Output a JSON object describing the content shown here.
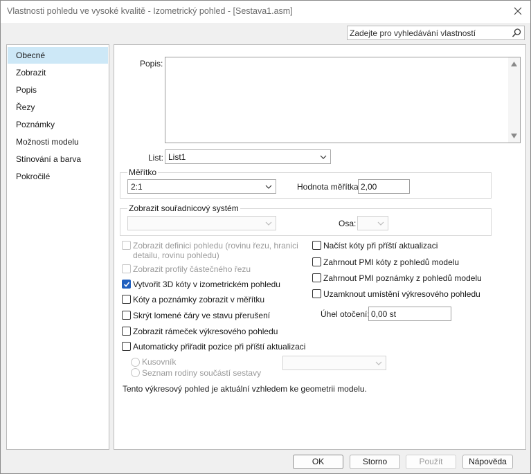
{
  "window": {
    "title": "Vlastnosti pohledu ve vysoké kvalitě - Izometrický pohled - [Sestava1.asm]"
  },
  "search": {
    "placeholder": "Zadejte pro vyhledávání vlastností"
  },
  "sidebar": {
    "items": [
      {
        "label": "Obecné",
        "selected": true
      },
      {
        "label": "Zobrazit",
        "selected": false
      },
      {
        "label": "Popis",
        "selected": false
      },
      {
        "label": "Řezy",
        "selected": false
      },
      {
        "label": "Poznámky",
        "selected": false
      },
      {
        "label": "Možnosti modelu",
        "selected": false
      },
      {
        "label": "Stínování a barva",
        "selected": false
      },
      {
        "label": "Pokročilé",
        "selected": false
      }
    ]
  },
  "general": {
    "description_label": "Popis:",
    "description_value": "",
    "sheet_label": "List:",
    "sheet_value": "List1",
    "scale_group_title": "Měřítko",
    "scale_value": "2:1",
    "scale_factor_label": "Hodnota měřítka:",
    "scale_factor_value": "2,00",
    "coord_group_title": "Zobrazit souřadnicový systém",
    "coord_value": "",
    "axis_label": "Osa:",
    "axis_value": "",
    "rotation_label": "Úhel otočení:",
    "rotation_value": "0,00 st",
    "status_text": "Tento výkresový pohled je aktuální vzhledem ke geometrii modelu."
  },
  "checkboxes_left": [
    {
      "label_line1": "Zobrazit definici pohledu (rovinu řezu, hranici",
      "label_line2": "detailu, rovinu pohledu)",
      "checked": false,
      "enabled": false
    },
    {
      "label_line1": "Zobrazit profily částečného řezu",
      "checked": false,
      "enabled": false
    },
    {
      "label_line1": "Vytvořit 3D kóty v izometrickém pohledu",
      "checked": true,
      "enabled": true
    },
    {
      "label_line1": "Kóty a poznámky zobrazit v měřítku",
      "checked": false,
      "enabled": true
    },
    {
      "label_line1": "Skrýt lomené čáry ve stavu přerušení",
      "checked": false,
      "enabled": true
    },
    {
      "label_line1": "Zobrazit rámeček výkresového pohledu",
      "checked": false,
      "enabled": true
    },
    {
      "label_line1": "Automaticky přiřadit pozice při příští aktualizaci",
      "checked": false,
      "enabled": true
    }
  ],
  "checkboxes_right": [
    {
      "label": "Načíst kóty při příští aktualizaci",
      "checked": false
    },
    {
      "label": "Zahrnout PMI kóty z pohledů modelu",
      "checked": false
    },
    {
      "label": "Zahrnout PMI poznámky z pohledů modelu",
      "checked": false
    },
    {
      "label": "Uzamknout umístění výkresového pohledu",
      "checked": false
    }
  ],
  "radios": [
    {
      "label": "Kusovník",
      "enabled": false
    },
    {
      "label": "Seznam rodiny součástí sestavy",
      "enabled": false
    }
  ],
  "buttons": {
    "ok": "OK",
    "cancel": "Storno",
    "apply": "Použít",
    "help": "Nápověda"
  },
  "colors": {
    "selected_nav": "#cde8f7",
    "checkbox_checked": "#1f5fbf"
  }
}
